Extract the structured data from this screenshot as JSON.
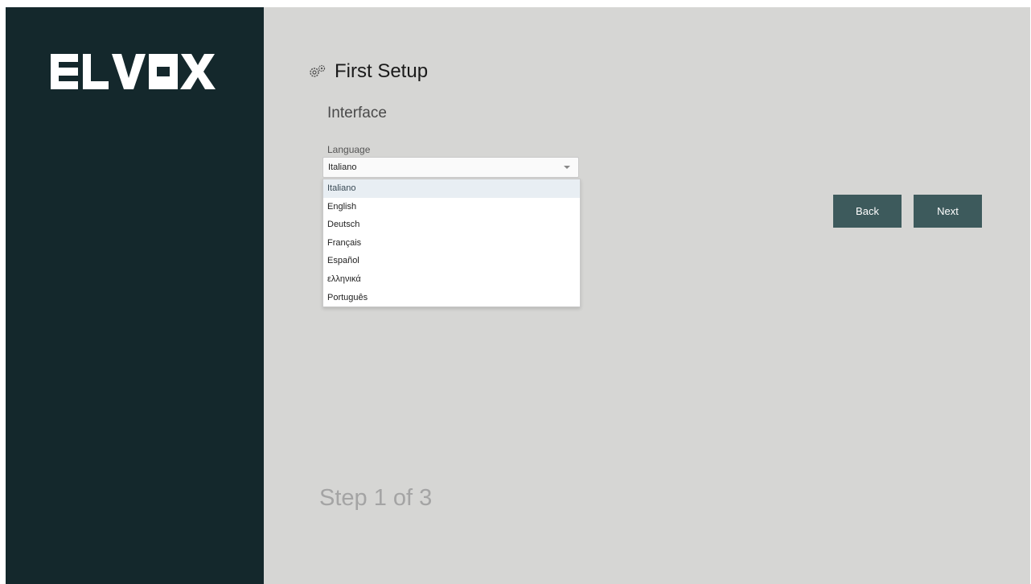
{
  "brand": {
    "logo_text": "ELVOX"
  },
  "header": {
    "title": "First Setup",
    "icon": "gears-icon"
  },
  "section": {
    "title": "Interface"
  },
  "language_field": {
    "label": "Language",
    "value": "Italiano",
    "options": [
      "Italiano",
      "English",
      "Deutsch",
      "Français",
      "Español",
      "ελληνικά",
      "Português"
    ]
  },
  "buttons": {
    "back": "Back",
    "next": "Next"
  },
  "footer": {
    "step": "Step 1 of 3"
  },
  "colors": {
    "sidebar": "#14282c",
    "content_background": "#d6d6d4",
    "button": "#3d5a5c",
    "selected_option": "#e8eef3"
  }
}
